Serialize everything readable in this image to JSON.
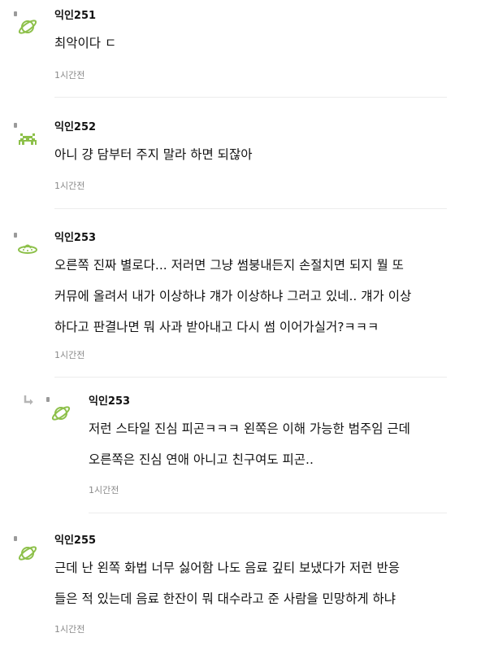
{
  "comments": [
    {
      "author": "익인251",
      "avatar_icon": "planet-icon",
      "lines": [
        "최악이다 ㄷ"
      ],
      "time": "1시간전"
    },
    {
      "author": "익인252",
      "avatar_icon": "space-invader-icon",
      "lines": [
        "아니 걍 담부터 주지 말라 하면 되잖아"
      ],
      "time": "1시간전"
    },
    {
      "author": "익인253",
      "avatar_icon": "ufo-icon",
      "lines": [
        "오른쪽 진짜 별로다... 저러면 그냥 썸붕내든지 손절치면 되지 뭘 또",
        "커뮤에 올려서 내가 이상하냐 걔가 이상하냐 그러고 있네.. 걔가 이상",
        "하다고 판결나면 뭐 사과 받아내고 다시 썸 이어가실거?ㅋㅋㅋ"
      ],
      "time": "1시간전"
    },
    {
      "author": "익인253",
      "avatar_icon": "planet-icon",
      "is_reply": true,
      "lines": [
        "저런 스타일 진심 피곤ㅋㅋㅋ 왼쪽은 이해 가능한 범주임 근데",
        "오른쪽은 진심 연애 아니고 친구여도 피곤.."
      ],
      "time": "1시간전"
    },
    {
      "author": "익인255",
      "avatar_icon": "planet-icon",
      "lines": [
        "근데 난 왼쪽 화법 너무 싫어함 나도 음료 깊티 보냈다가 저런 반응",
        "들은 적 있는데 음료 한잔이 뭐 대수라고 준 사람을 민망하게 하냐"
      ],
      "time": "1시간전"
    }
  ],
  "colors": {
    "avatar_green": "#8dc04a",
    "text": "#111111",
    "time": "#8a8a8a",
    "divider": "#ececec"
  }
}
